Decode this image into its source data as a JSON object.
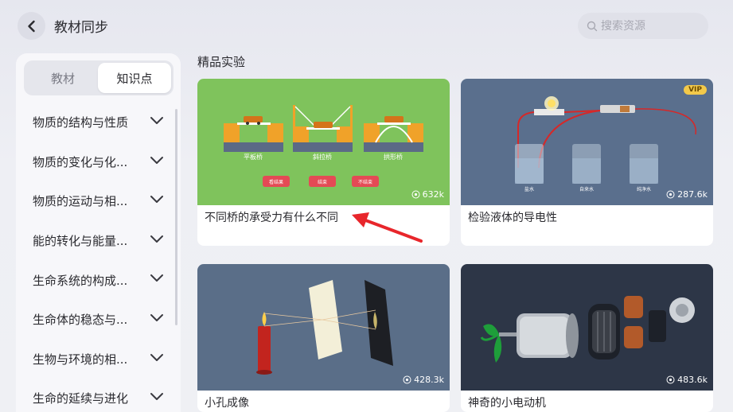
{
  "header": {
    "title": "教材同步",
    "search_placeholder": "搜索资源",
    "back_icon": "chevron-left-icon",
    "search_icon": "search-icon"
  },
  "sidebar": {
    "tabs": [
      {
        "label": "教材",
        "selected": false
      },
      {
        "label": "知识点",
        "selected": true
      }
    ],
    "categories": [
      {
        "label": "物质的结构与性质"
      },
      {
        "label": "物质的变化与化..."
      },
      {
        "label": "物质的运动与相..."
      },
      {
        "label": "能的转化与能量..."
      },
      {
        "label": "生命系统的构成..."
      },
      {
        "label": "生命体的稳态与..."
      },
      {
        "label": "生物与环境的相..."
      },
      {
        "label": "生命的延续与进化"
      }
    ]
  },
  "main": {
    "section_title": "精品实验",
    "cards": [
      {
        "title": "不同桥的承受力有什么不同",
        "views": "632k",
        "vip": false,
        "thumb_labels": [
          "平板桥",
          "斜拉桥",
          "拱形桥"
        ],
        "thumb_buttons": [
          "看结果",
          "结束",
          "不结束"
        ],
        "thumb_bg": "#7fc35c"
      },
      {
        "title": "检验液体的导电性",
        "views": "287.6k",
        "vip": true,
        "vip_label": "VIP",
        "thumb_labels": [
          "盐水",
          "自来水",
          "纯净水"
        ],
        "thumb_bg": "#5a6f8d"
      },
      {
        "title": "小孔成像",
        "views": "428.3k",
        "vip": false,
        "thumb_bg": "#5a6e88"
      },
      {
        "title": "神奇的小电动机",
        "views": "483.6k",
        "vip": false,
        "thumb_bg": "#2d3647"
      }
    ]
  },
  "colors": {
    "accent_red": "#e8262b",
    "vip_gold": "#f3c94a",
    "background": "#eeeff4"
  }
}
